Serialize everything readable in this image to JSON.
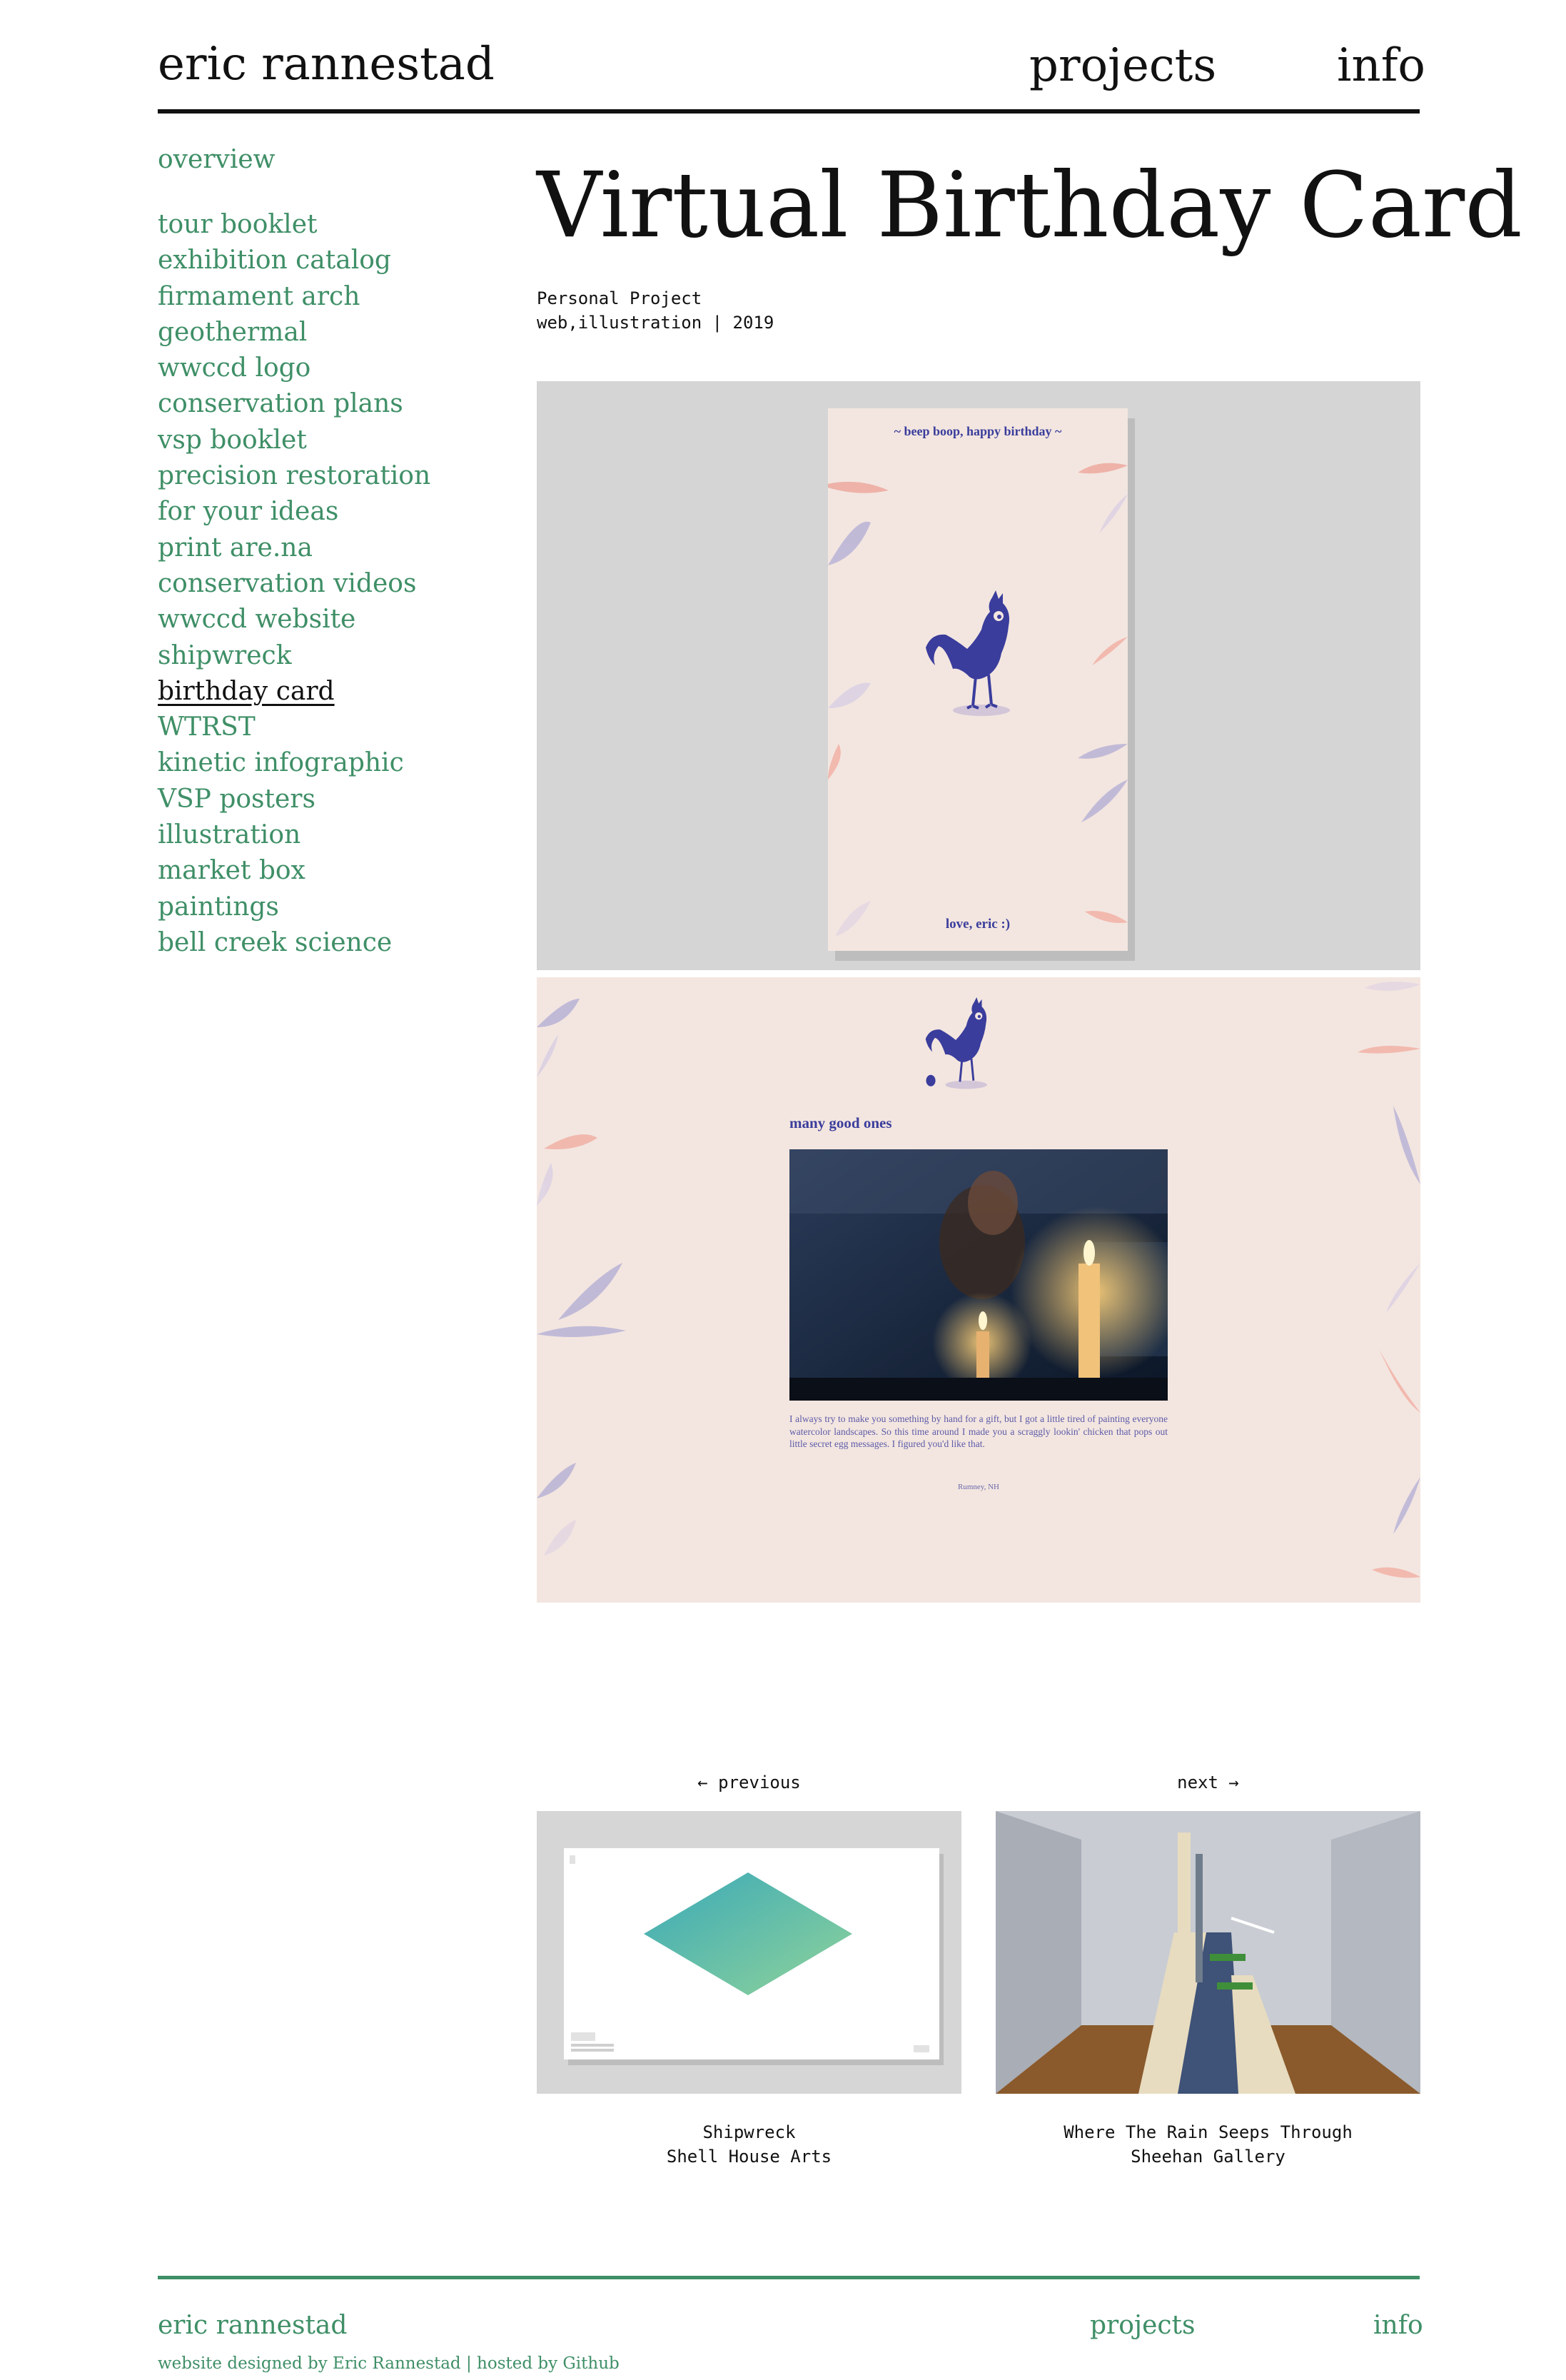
{
  "header": {
    "site_name": "eric rannestad",
    "nav": {
      "projects": "projects",
      "info": "info"
    }
  },
  "sidebar": {
    "overview": "overview",
    "items": [
      "tour booklet",
      "exhibition catalog",
      "firmament arch",
      "geothermal",
      "wwccd logo",
      "conservation plans",
      "vsp booklet",
      "precision restoration",
      "for your ideas",
      "print are.na",
      "conservation videos",
      "wwccd website",
      "shipwreck",
      "birthday card",
      "WTRST",
      "kinetic infographic",
      "VSP posters",
      "illustration",
      "market box",
      "paintings",
      "bell creek science"
    ],
    "active_item": "birthday card"
  },
  "project": {
    "title": "Virtual Birthday Card",
    "type": "Personal Project",
    "tags_year": "web,illustration | 2019"
  },
  "image_1": {
    "top_text": "~ beep boop, happy birthday ~",
    "bottom_text": "love, eric :)"
  },
  "image_2": {
    "heading": "many good ones",
    "paragraph": "I always try to make you something by hand for a gift, but I got a little tired of painting everyone watercolor landscapes. So this time around I made you a scraggly lookin' chicken that pops out little secret egg messages. I figured you'd like that.",
    "location": "Rumney, NH"
  },
  "pagination": {
    "previous_label": "← previous",
    "next_label": "next →",
    "previous": {
      "title": "Shipwreck",
      "subtitle": "Shell House Arts"
    },
    "next": {
      "title": "Where The Rain Seeps Through",
      "subtitle": "Sheehan Gallery"
    }
  },
  "footer": {
    "site_name": "eric rannestad",
    "projects": "projects",
    "info": "info",
    "credit": "website designed by Eric Rannestad | hosted by Github"
  },
  "colors": {
    "accent_green": "#3f8f67",
    "card_pink": "#f3e6e0",
    "ink_blue": "#3a3d9c",
    "panel_gray": "#d5d5d5"
  }
}
